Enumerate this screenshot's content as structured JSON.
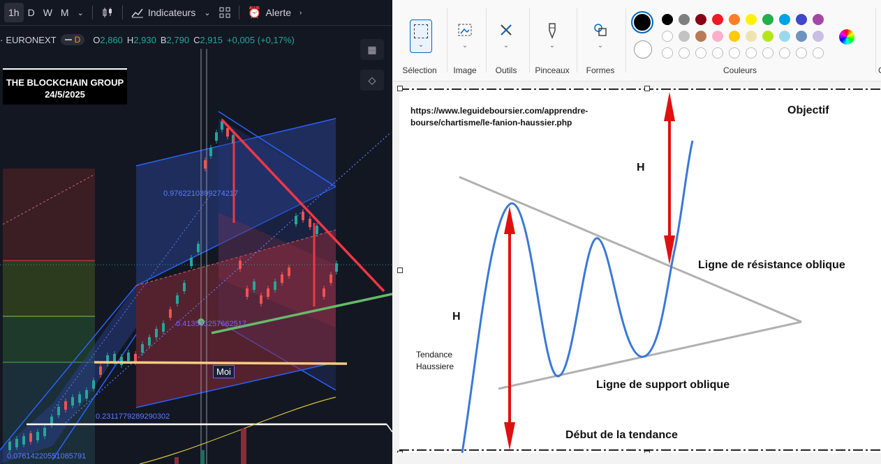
{
  "tradingview": {
    "toolbar": {
      "intervals": [
        "1h",
        "D",
        "W",
        "M"
      ],
      "indicators_label": "Indicateurs",
      "alert_label": "Alerte"
    },
    "symbol": {
      "exchange": "EURONEXT",
      "pill_label": "D",
      "open_label": "O",
      "open": "2,860",
      "high_label": "H",
      "high": "2,930",
      "low_label": "B",
      "low": "2,790",
      "close_label": "C",
      "close": "2,915",
      "change": "+0,005 (+0,17%)"
    },
    "banner": {
      "title": "THE BLOCKCHAIN GROUP",
      "date": "24/5/2025"
    },
    "fib_labels": [
      "0.9762210399274217",
      "0.413533257662517",
      "0.2311779289290302",
      "0.07614220551085791"
    ],
    "moi_label": "Moi",
    "colors": {
      "bg": "#131722",
      "up": "#26a69a",
      "down": "#ef5350",
      "blue": "#2962ff"
    }
  },
  "paint": {
    "groups": [
      {
        "label": "Sélection",
        "icon": "selection-icon"
      },
      {
        "label": "Image",
        "icon": "image-icon"
      },
      {
        "label": "Outils",
        "icon": "tools-icon"
      },
      {
        "label": "Pinceaux",
        "icon": "brush-icon"
      },
      {
        "label": "Formes",
        "icon": "shapes-icon"
      }
    ],
    "colors_label": "Couleurs",
    "palette_row1": [
      "#000000",
      "#7f7f7f",
      "#880015",
      "#ed1c24",
      "#ff7f27",
      "#fff200",
      "#22b14c",
      "#00a2e8",
      "#3f48cc",
      "#a349a4"
    ],
    "palette_row2": [
      "#ffffff",
      "#c3c3c3",
      "#b97a57",
      "#ffaec9",
      "#ffc90e",
      "#efe4b0",
      "#b5e61d",
      "#99d9ea",
      "#7092be",
      "#c8bfe7"
    ],
    "canvas": {
      "url_line1": "https://www.leguideboursier.com/apprendre-",
      "url_line2": "bourse/chartisme/le-fanion-haussier.php",
      "objectif": "Objectif",
      "h_label": "H",
      "resistance": "Ligne de résistance oblique",
      "support": "Ligne de support oblique",
      "tendance_line1": "Tendance",
      "tendance_line2": "Haussiere",
      "debut": "Début de la tendance"
    }
  }
}
